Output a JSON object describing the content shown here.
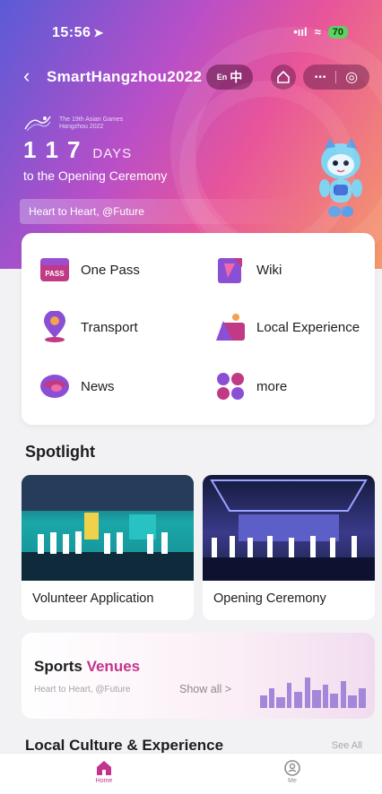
{
  "status_bar": {
    "time": "15:56",
    "signal": "•ııl",
    "wifi": "≈",
    "battery": "70"
  },
  "nav": {
    "back": "‹",
    "title": "SmartHangzhou2022",
    "lang_prefix": "En",
    "lang_current": "中",
    "favorite_icon": "house-star-icon",
    "more": "•••",
    "close": "◎"
  },
  "hero": {
    "games_name_line1": "The 19th Asian Games",
    "games_name_line2": "Hangzhou 2022",
    "countdown_digits": [
      "1",
      "1",
      "7"
    ],
    "days_label": "DAYS",
    "opening_text": "to the Opening Ceremony",
    "slogan": "Heart to Heart, @Future"
  },
  "services": [
    {
      "label": "One Pass",
      "icon": "one-pass-icon",
      "badge": "PASS"
    },
    {
      "label": "Wiki",
      "icon": "wiki-icon"
    },
    {
      "label": "Transport",
      "icon": "transport-pin-icon"
    },
    {
      "label": "Local Experience",
      "icon": "local-experience-icon"
    },
    {
      "label": "News",
      "icon": "news-icon"
    },
    {
      "label": "more",
      "icon": "more-grid-icon"
    }
  ],
  "spotlight": {
    "title": "Spotlight",
    "cards": [
      {
        "label": "Volunteer Application"
      },
      {
        "label": "Opening Ceremony"
      }
    ]
  },
  "venues": {
    "title_a": "Sports",
    "title_b": "Venues",
    "subtitle": "Heart to Heart, @Future",
    "link": "Show all  >"
  },
  "culture": {
    "title": "Local Culture & Experience",
    "see_all": "See All"
  },
  "tabbar": [
    {
      "label": "Home",
      "icon": "home-icon",
      "active": true
    },
    {
      "label": "Me",
      "icon": "profile-icon",
      "active": false
    }
  ],
  "colors": {
    "accent": "#c3348d",
    "brand_purple": "#6b5bd6",
    "brand_pink": "#e8559a"
  }
}
